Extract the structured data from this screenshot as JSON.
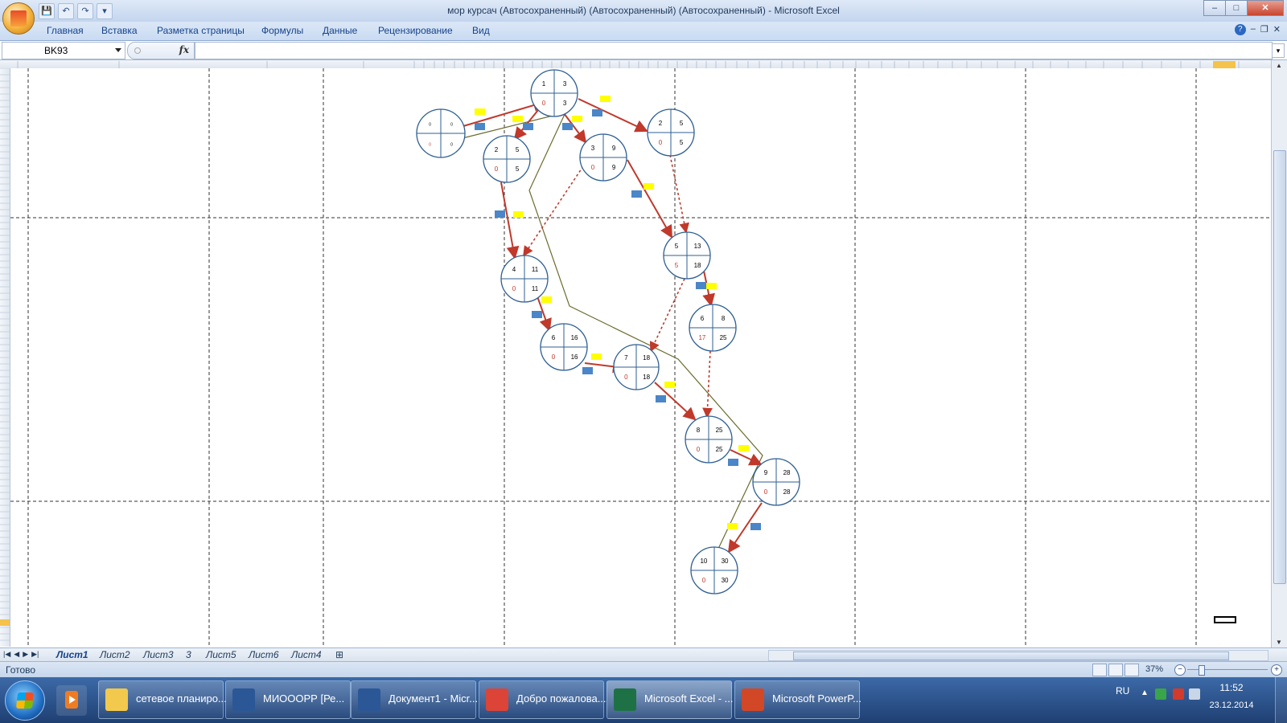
{
  "window": {
    "title": "мор курсач (Автосохраненный) (Автосохраненный) (Автосохраненный) - Microsoft Excel",
    "controls": {
      "minimize": "–",
      "maximize": "□",
      "close": "✕"
    },
    "ribbon_controls": {
      "help": "?",
      "minimize": "–",
      "restore": "❐",
      "close": "✕"
    },
    "qat": {
      "save": "💾",
      "undo": "↶",
      "redo": "↷",
      "customize": "▾"
    }
  },
  "ribbon": {
    "tabs": [
      "Главная",
      "Вставка",
      "Разметка страницы",
      "Формулы",
      "Данные",
      "Рецензирование",
      "Вид"
    ]
  },
  "formula_bar": {
    "name_box": "BK93",
    "fx": "fx",
    "value": ""
  },
  "sheets": {
    "tabs": [
      "Лист1",
      "Лист2",
      "Лист3",
      "3",
      "Лист5",
      "Лист6",
      "Лист4"
    ],
    "active": "Лист1"
  },
  "status": {
    "text": "Готово",
    "zoom": "37%"
  },
  "taskbar": {
    "items": [
      {
        "label": "сетевое планиро...",
        "icon": "folder-icon",
        "color": "#f2c94c"
      },
      {
        "label": "МИОООРР [Ре...",
        "icon": "word-icon",
        "color": "#2b5797"
      },
      {
        "label": "Документ1 - Micr...",
        "icon": "word-icon",
        "color": "#2b5797"
      },
      {
        "label": "Добро пожалова...",
        "icon": "chrome-icon",
        "color": "#db4437"
      },
      {
        "label": "Microsoft Excel - ...",
        "icon": "excel-icon",
        "color": "#1e7145"
      },
      {
        "label": "Microsoft PowerP...",
        "icon": "powerpoint-icon",
        "color": "#d24726"
      }
    ],
    "lang": "RU",
    "time": "11:52",
    "date": "23.12.2014"
  },
  "network": {
    "nodes": [
      {
        "id": "n0",
        "tl": "0",
        "tr": "0",
        "bl": "0",
        "br": "0",
        "small": true
      },
      {
        "id": "n1",
        "tl": "1",
        "tr": "3",
        "bl": "0",
        "br": "3"
      },
      {
        "id": "n2",
        "tl": "2",
        "tr": "5",
        "bl": "0",
        "br": "5"
      },
      {
        "id": "n3",
        "tl": "3",
        "tr": "9",
        "bl": "0",
        "br": "9"
      },
      {
        "id": "n2b",
        "tl": "2",
        "tr": "5",
        "bl": "0",
        "br": "5"
      },
      {
        "id": "n4",
        "tl": "4",
        "tr": "11",
        "bl": "0",
        "br": "11"
      },
      {
        "id": "n5",
        "tl": "5",
        "tr": "13",
        "bl": "5",
        "br": "18"
      },
      {
        "id": "n6a",
        "tl": "6",
        "tr": "8",
        "bl": "17",
        "br": "25"
      },
      {
        "id": "n6b",
        "tl": "6",
        "tr": "16",
        "bl": "0",
        "br": "16"
      },
      {
        "id": "n7",
        "tl": "7",
        "tr": "18",
        "bl": "0",
        "br": "18"
      },
      {
        "id": "n8",
        "tl": "8",
        "tr": "25",
        "bl": "0",
        "br": "25"
      },
      {
        "id": "n9",
        "tl": "9",
        "tr": "28",
        "bl": "0",
        "br": "28"
      },
      {
        "id": "n10",
        "tl": "10",
        "tr": "30",
        "bl": "0",
        "br": "30"
      }
    ]
  },
  "colors": {
    "critical_arrow": "#c0392b",
    "path_line": "#6b6b2e",
    "node_stroke": "#2e5f93",
    "yellow_label": "#ffff00",
    "blue_label": "#4a86c8"
  }
}
